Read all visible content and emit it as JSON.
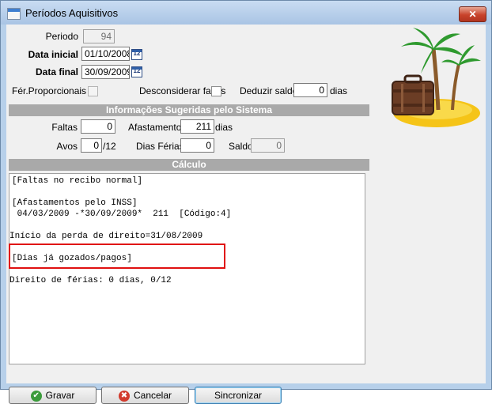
{
  "window": {
    "title": "Períodos Aquisitivos",
    "close_glyph": "✕"
  },
  "form": {
    "periodo": {
      "label": "Periodo",
      "value": "94"
    },
    "data_inicial": {
      "label": "Data inicial",
      "value": "01/10/2008"
    },
    "data_final": {
      "label": "Data final",
      "value": "30/09/2009"
    },
    "calendar_glyph": "12",
    "fer_proporcionais": {
      "label": "Fér.Proporcionais",
      "checked": false
    },
    "desconsiderar_faltas": {
      "label": "Desconsiderar faltas",
      "checked": false
    },
    "deduzir_saldo": {
      "label": "Deduzir saldo",
      "value": "0",
      "unit": "dias"
    }
  },
  "sugeridas": {
    "header": "Informações Sugeridas pelo Sistema",
    "faltas": {
      "label": "Faltas",
      "value": "0"
    },
    "afastamento": {
      "label": "Afastamento",
      "value": "211",
      "unit": "dias"
    },
    "avos": {
      "label": "Avos",
      "value": "0",
      "unit": "/12"
    },
    "dias_ferias": {
      "label": "Dias Férias",
      "value": "0"
    },
    "saldo": {
      "label": "Saldo",
      "value": "0"
    }
  },
  "calculo": {
    "header": "Cálculo",
    "lines": [
      "[Faltas no recibo normal]",
      "",
      "[Afastamentos pelo INSS]",
      " 04/03/2009 -*30/09/2009*  211  [Código:4]",
      "",
      "Início da perda de direito=31/08/2009",
      "",
      "[Dias já gozados/pagos]",
      "",
      "Direito de férias: 0 dias, 0/12"
    ]
  },
  "buttons": {
    "gravar": "Gravar",
    "cancelar": "Cancelar",
    "sincronizar": "Sincronizar"
  },
  "colors": {
    "section_bg": "#a9a9a9",
    "highlight": "#e01010",
    "frame": "#b7d0ea"
  }
}
